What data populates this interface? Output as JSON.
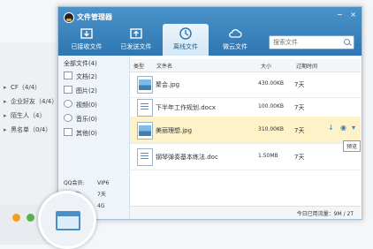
{
  "window": {
    "title": "文件管理器"
  },
  "tabs": [
    {
      "label": "已接收文件"
    },
    {
      "label": "已发送文件"
    },
    {
      "label": "离线文件"
    },
    {
      "label": "微云文件"
    }
  ],
  "search": {
    "placeholder": "搜索文件"
  },
  "sidebar": {
    "all_files": "全部文件(4)",
    "items": [
      {
        "label": "文档(2)"
      },
      {
        "label": "图片(2)"
      },
      {
        "label": "视频(0)"
      },
      {
        "label": "音乐(0)"
      },
      {
        "label": "其他(0)"
      }
    ],
    "info": [
      {
        "key": "QQ会员:",
        "value": "VIP6"
      },
      {
        "key": "存放期:",
        "value": "7天"
      },
      {
        "key": "单文件限制:",
        "value": "4G"
      }
    ]
  },
  "table": {
    "headers": [
      "类型",
      "文件名",
      "大小",
      "过期时间"
    ],
    "rows": [
      {
        "name": "聚会.jpg",
        "size": "430.00KB",
        "expire": "7天",
        "kind": "image"
      },
      {
        "name": "下半年工作规划.docx",
        "size": "100.00KB",
        "expire": "7天",
        "kind": "doc"
      },
      {
        "name": "美丽理想.jpg",
        "size": "310.00KB",
        "expire": "7天",
        "kind": "image"
      },
      {
        "name": "钢琴弹奏基本练法.doc",
        "size": "1.50MB",
        "expire": "7天",
        "kind": "doc"
      }
    ]
  },
  "tooltip": "预览",
  "footer": {
    "status": "今日已用流量：9M / 2T"
  },
  "background_contacts": [
    {
      "label": "CF（4/4）"
    },
    {
      "label": "企业好友（4/4）"
    },
    {
      "label": "陌生人（4）"
    },
    {
      "label": "黑名单（0/4）"
    }
  ],
  "colors": {
    "header": "#3a84be",
    "selected_row": "#fdf2c8",
    "accent": "#3c7fb8"
  }
}
